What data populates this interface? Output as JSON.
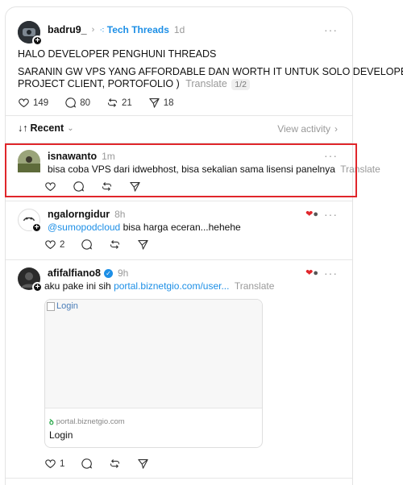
{
  "op_post": {
    "username": "badru9_",
    "topic": "Tech Threads",
    "time": "1d",
    "line1": "HALO DEVELOPER PENGHUNI THREADS",
    "line2": "SARANIN GW VPS YANG AFFORDABLE DAN WORTH IT UNTUK SOLO DEVELOPER (",
    "line3": "PROJECT CLIENT, PORTOFOLIO )",
    "translate": "Translate",
    "page": "1/2",
    "likes": "149",
    "comments": "80",
    "reposts": "21",
    "shares": "18"
  },
  "sort": {
    "label": "Recent",
    "view_activity": "View activity"
  },
  "replies": [
    {
      "username": "isnawanto",
      "time": "1m",
      "text": "bisa coba VPS dari idwebhost, bisa sekalian sama lisensi panelnya",
      "translate": "Translate"
    },
    {
      "username": "ngalorngidur",
      "time": "8h",
      "mention": "@sumopodcloud",
      "text": " bisa harga eceran...hehehe",
      "likes": "2"
    },
    {
      "username": "afifalfiano8",
      "time": "9h",
      "text": "aku pake ini sih ",
      "link": "portal.biznetgio.com/user...",
      "translate": "Translate",
      "likes": "1",
      "preview": {
        "alt": "Login",
        "domain": "portal.biznetgio.com",
        "title": "Login"
      }
    }
  ],
  "colors": {
    "accent": "#1d8fe6",
    "highlight": "#e0262b",
    "verified": "#1d8fe6"
  }
}
